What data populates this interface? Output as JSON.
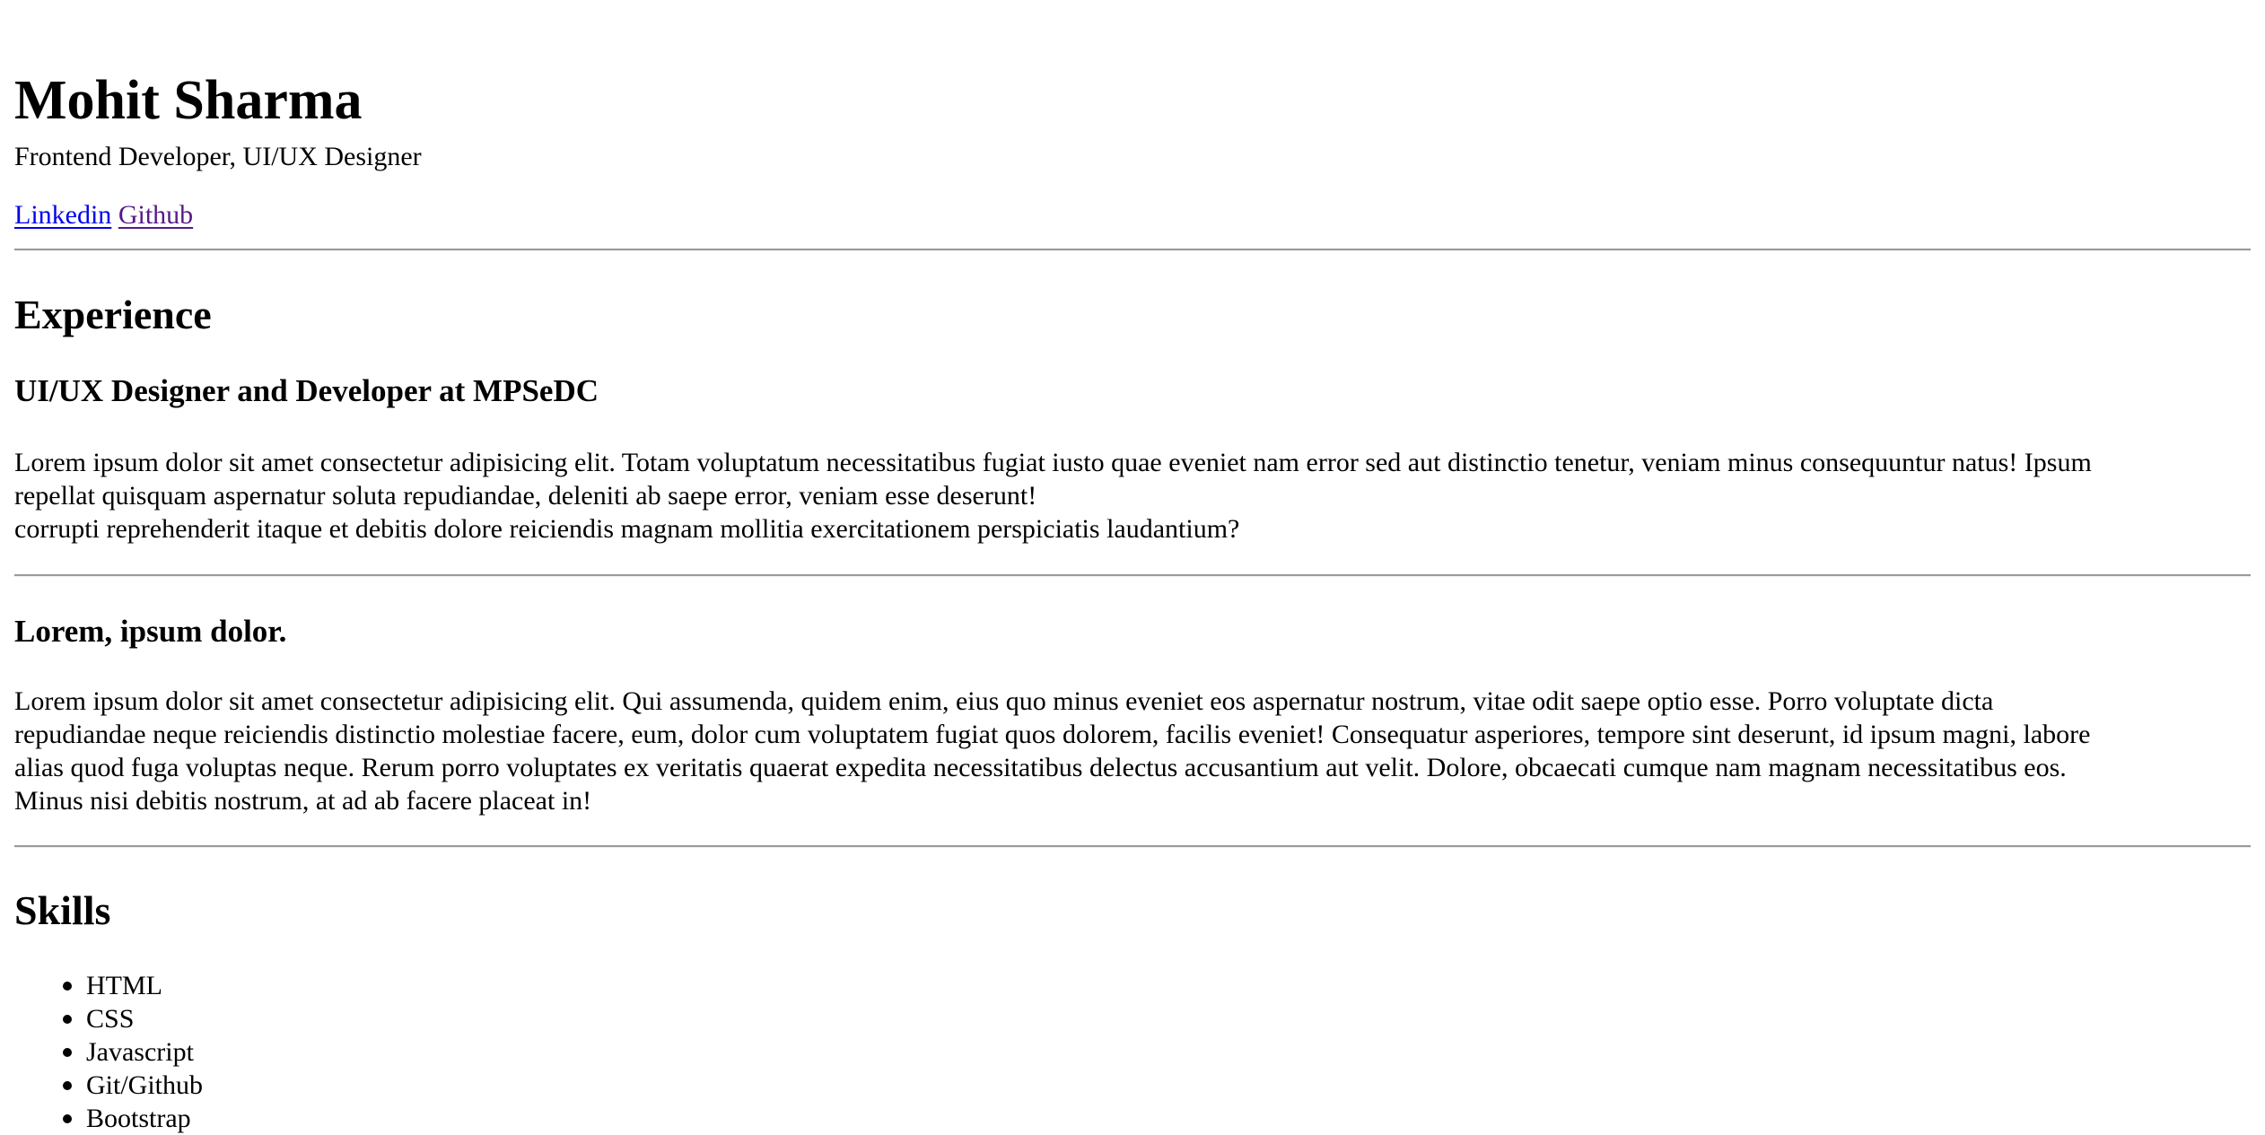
{
  "header": {
    "name": "Mohit Sharma",
    "tagline": "Frontend Developer, UI/UX Designer",
    "links": [
      {
        "label": "Linkedin"
      },
      {
        "label": "Github"
      }
    ]
  },
  "experience": {
    "heading": "Experience",
    "jobs": [
      {
        "title": "UI/UX Designer and Developer at MPSeDC",
        "lines": [
          "Lorem ipsum dolor sit amet consectetur adipisicing elit. Totam voluptatum necessitatibus fugiat iusto quae eveniet nam error sed aut distinctio tenetur, veniam minus consequuntur natus! Ipsum",
          "repellat quisquam aspernatur soluta repudiandae, deleniti ab saepe error, veniam esse deserunt!",
          "corrupti reprehenderit itaque et debitis dolore reiciendis magnam mollitia exercitationem perspiciatis laudantium?"
        ]
      },
      {
        "title": "Lorem, ipsum dolor.",
        "lines": [
          "Lorem ipsum dolor sit amet consectetur adipisicing elit. Qui assumenda, quidem enim, eius quo minus eveniet eos aspernatur nostrum, vitae odit saepe optio esse. Porro voluptate dicta",
          "repudiandae neque reiciendis distinctio molestiae facere, eum, dolor cum voluptatem fugiat quos dolorem, facilis eveniet! Consequatur asperiores, tempore sint deserunt, id ipsum magni, labore",
          "alias quod fuga voluptas neque. Rerum porro voluptates ex veritatis quaerat expedita necessitatibus delectus accusantium aut velit. Dolore, obcaecati cumque nam magnam necessitatibus eos.",
          "Minus nisi debitis nostrum, at ad ab facere placeat in!"
        ]
      }
    ]
  },
  "skills": {
    "heading": "Skills",
    "items": [
      "HTML",
      "CSS",
      "Javascript",
      "Git/Github",
      "Bootstrap"
    ]
  }
}
